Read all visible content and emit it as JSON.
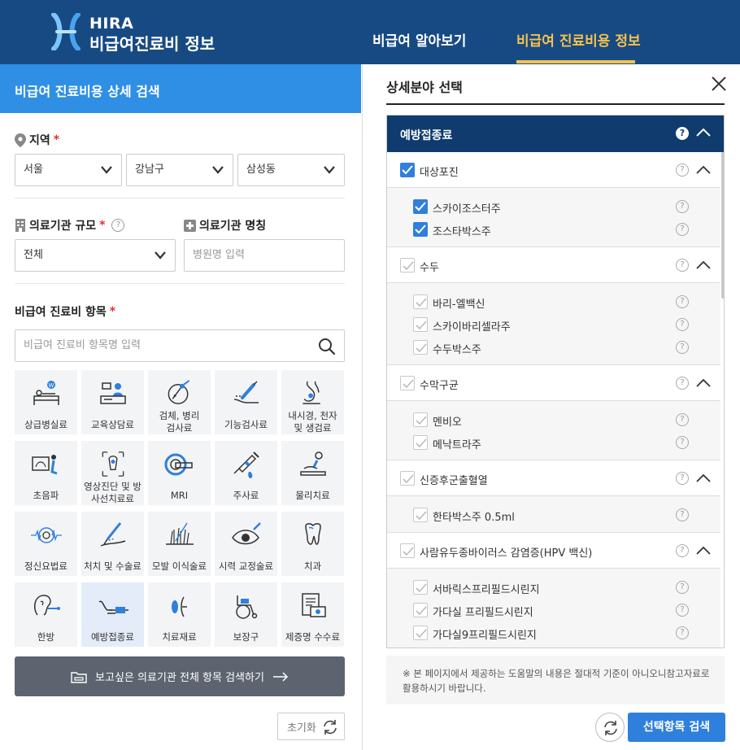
{
  "header": {
    "logo_line1": "HIRA",
    "logo_line2": "비급여진료비 정보",
    "nav": [
      {
        "label": "비급여 알아보기",
        "active": false
      },
      {
        "label": "비급여 진료비용 정보",
        "active": true
      }
    ],
    "accent_color": "#f5c24d",
    "bg_color": "#174a83"
  },
  "left": {
    "title": "비급여 진료비용 상세 검색",
    "region": {
      "label": "지역",
      "required_mark": "*",
      "selects": [
        "서울",
        "강남구",
        "삼성동"
      ]
    },
    "institution_size": {
      "label": "의료기관 규모",
      "required_mark": "*",
      "help": "?",
      "value": "전체"
    },
    "institution_name": {
      "label": "의료기관 명칭",
      "placeholder": "병원명 입력"
    },
    "items": {
      "label": "비급여 진료비 항목",
      "required_mark": "*",
      "placeholder": "비급여 진료비 항목명 입력",
      "tiles": [
        {
          "label": "상급병실료",
          "icon": "hospital-bed-icon"
        },
        {
          "label": "교육상담료",
          "icon": "counseling-icon"
        },
        {
          "label": "검체, 병리 검사료",
          "icon": "microscope-icon"
        },
        {
          "label": "기능검사료",
          "icon": "function-test-icon"
        },
        {
          "label": "내시경, 천자 및 생검료",
          "icon": "endoscope-icon"
        },
        {
          "label": "초음파",
          "icon": "ultrasound-icon"
        },
        {
          "label": "영상진단 및 방사선치료료",
          "icon": "radiology-icon"
        },
        {
          "label": "MRI",
          "icon": "mri-icon"
        },
        {
          "label": "주사료",
          "icon": "syringe-icon"
        },
        {
          "label": "물리치료",
          "icon": "physical-therapy-icon"
        },
        {
          "label": "정신요법료",
          "icon": "brain-icon"
        },
        {
          "label": "처치 및 수술료",
          "icon": "surgery-icon"
        },
        {
          "label": "모발 이식술료",
          "icon": "hair-transplant-icon"
        },
        {
          "label": "시력 교정술료",
          "icon": "eye-icon"
        },
        {
          "label": "치과",
          "icon": "tooth-icon"
        },
        {
          "label": "한방",
          "icon": "acupuncture-icon"
        },
        {
          "label": "예방접종료",
          "icon": "vaccination-icon",
          "selected": true
        },
        {
          "label": "치료재료",
          "icon": "treatment-material-icon"
        },
        {
          "label": "보장구",
          "icon": "wheelchair-icon"
        },
        {
          "label": "제증명 수수료",
          "icon": "certificate-icon"
        }
      ]
    },
    "search_all_button": "보고싶은 의료기관 전체 항목 검색하기",
    "reset_button": "초기화"
  },
  "right": {
    "title": "상세분야 선택",
    "section_title": "예방접종료",
    "groups": [
      {
        "label": "대상포진",
        "checked": true,
        "items": [
          {
            "label": "스카이조스터주",
            "checked": true
          },
          {
            "label": "조스타박스주",
            "checked": true
          }
        ]
      },
      {
        "label": "수두",
        "checked": false,
        "items": [
          {
            "label": "바리-엘백신",
            "checked": false
          },
          {
            "label": "스카이바리셀라주",
            "checked": false
          },
          {
            "label": "수두박스주",
            "checked": false
          }
        ]
      },
      {
        "label": "수막구균",
        "checked": false,
        "items": [
          {
            "label": "멘비오",
            "checked": false
          },
          {
            "label": "메낙트라주",
            "checked": false
          }
        ]
      },
      {
        "label": "신증후군출혈열",
        "checked": false,
        "items": [
          {
            "label": "한타박스주 0.5ml",
            "checked": false
          }
        ]
      },
      {
        "label": "사람유두종바이러스 감염증(HPV 백신)",
        "checked": false,
        "items": [
          {
            "label": "서바릭스프리필드시린지",
            "checked": false
          },
          {
            "label": "가다실 프리필드시린지",
            "checked": false
          },
          {
            "label": "가다실9프리필드시린지",
            "checked": false
          }
        ]
      }
    ],
    "notice": "※ 본 페이지에서 제공하는 도움말의 내용은 절대적 기준이 아니오니참고자료로 활용하시기 바랍니다.",
    "search_button": "선택항목 검색"
  }
}
